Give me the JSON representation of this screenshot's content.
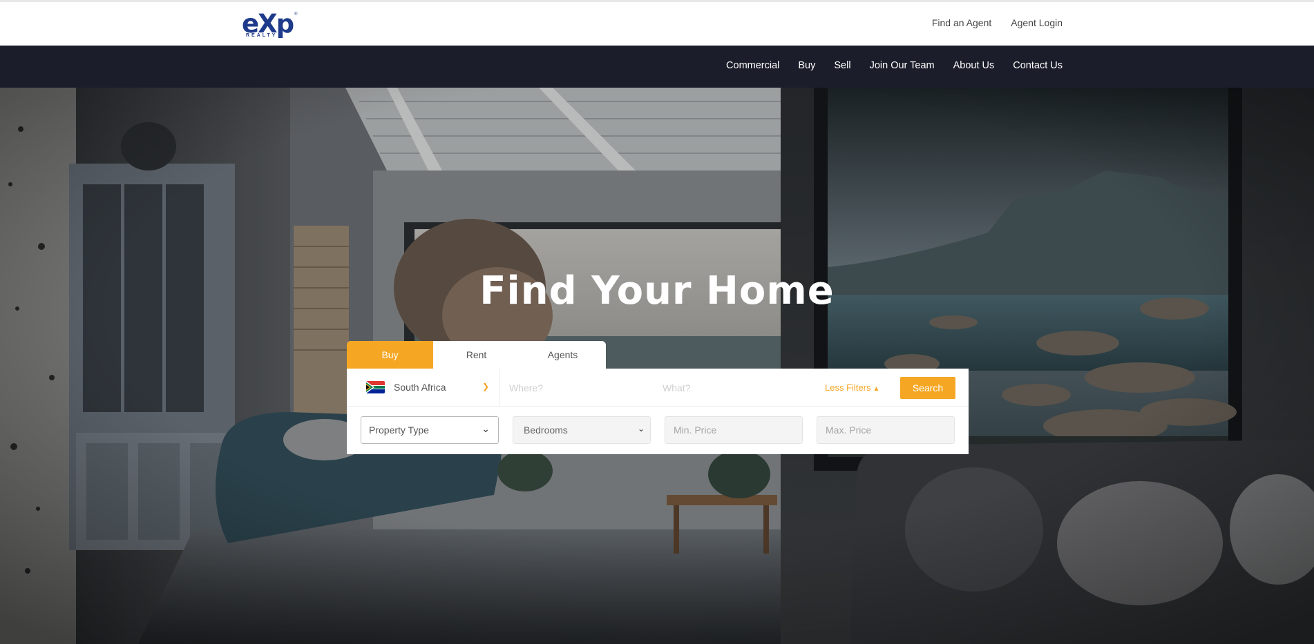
{
  "header": {
    "logo": {
      "wordmark": "eXp",
      "subtitle": "REALTY",
      "icon": "exp-realty-logo"
    },
    "top_links": [
      "Find an Agent",
      "Agent Login"
    ]
  },
  "nav": {
    "items": [
      "Commercial",
      "Buy",
      "Sell",
      "Join Our Team",
      "About Us",
      "Contact Us"
    ]
  },
  "hero": {
    "title": "Find Your Home"
  },
  "search": {
    "tabs": [
      {
        "label": "Buy",
        "active": true
      },
      {
        "label": "Rent",
        "active": false
      },
      {
        "label": "Agents",
        "active": false
      }
    ],
    "country": {
      "label": "South Africa",
      "flag_icon": "south-africa-flag-icon"
    },
    "where_placeholder": "Where?",
    "what_placeholder": "What?",
    "less_filters_label": "Less Filters",
    "search_label": "Search",
    "property_type_label": "Property Type",
    "bedrooms_label": "Bedrooms",
    "min_price_placeholder": "Min. Price",
    "max_price_placeholder": "Max. Price"
  },
  "colors": {
    "accent": "#f5a623",
    "navbar": "#1b1e2a",
    "brand": "#1e3a8a"
  }
}
